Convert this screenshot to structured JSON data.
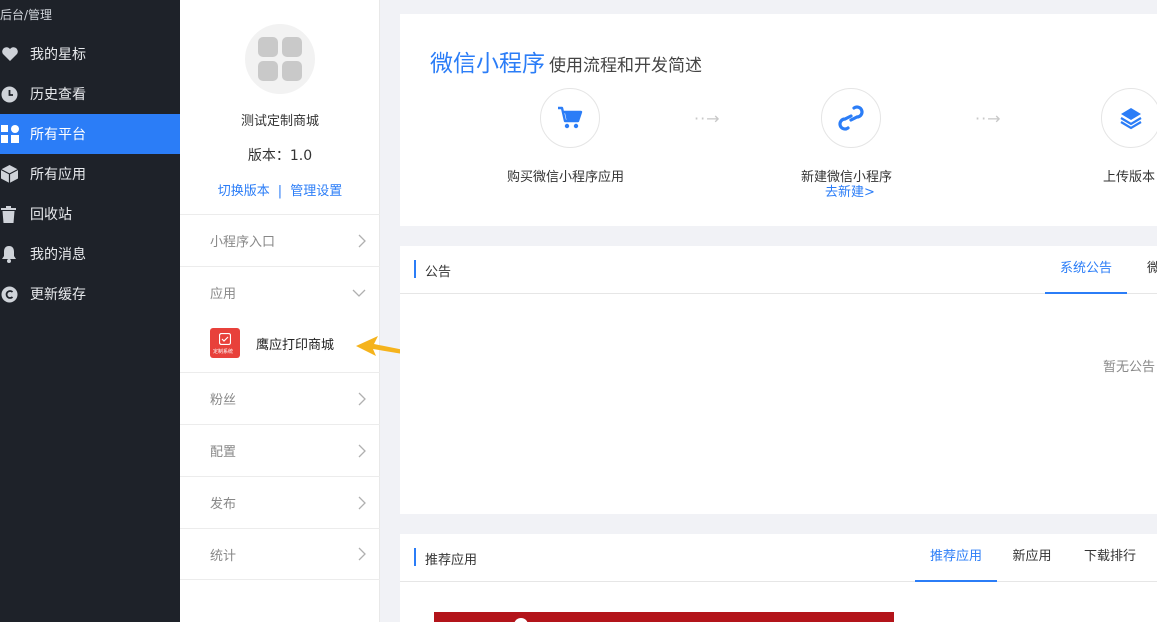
{
  "breadcrumb": "后台/管理",
  "leftnav": {
    "items": [
      {
        "label": "我的星标",
        "icon": "heart-icon"
      },
      {
        "label": "历史查看",
        "icon": "clock-icon"
      },
      {
        "label": "所有平台",
        "icon": "grid-icon",
        "active": true
      },
      {
        "label": "所有应用",
        "icon": "cube-icon"
      },
      {
        "label": "回收站",
        "icon": "trash-icon"
      },
      {
        "label": "我的消息",
        "icon": "bell-icon"
      },
      {
        "label": "更新缓存",
        "icon": "refresh-icon"
      }
    ]
  },
  "app": {
    "name": "测试定制商城",
    "version_label": "版本：",
    "version": "1.0",
    "switch_version": "切换版本",
    "separator": "|",
    "manage_settings": "管理设置",
    "menu": [
      {
        "label": "小程序入口"
      },
      {
        "label": "应用"
      },
      {
        "label": "粉丝"
      },
      {
        "label": "配置"
      },
      {
        "label": "发布"
      },
      {
        "label": "统计"
      }
    ],
    "sub_app": {
      "label": "鹰应打印商城",
      "thumb_text": "定制系统"
    }
  },
  "flow": {
    "title_big": "微信小程序",
    "title_small": "使用流程和开发简述",
    "steps": [
      {
        "label": "购买微信小程序应用",
        "icon": "cart-icon"
      },
      {
        "label": "新建微信小程序",
        "icon": "link-icon",
        "link": "去新建>"
      },
      {
        "label": "上传版本",
        "icon": "layers-icon"
      }
    ],
    "arrow": "··→"
  },
  "notice": {
    "title": "公告",
    "tabs": [
      "系统公告",
      "微"
    ],
    "empty": "暂无公告"
  },
  "recommend": {
    "title": "推荐应用",
    "tabs": [
      "推荐应用",
      "新应用",
      "下载排行"
    ]
  },
  "colors": {
    "accent": "#2b7df7",
    "nav_bg": "#1e2229",
    "annotation": "#f5b31c",
    "banner": "#b3141a"
  }
}
